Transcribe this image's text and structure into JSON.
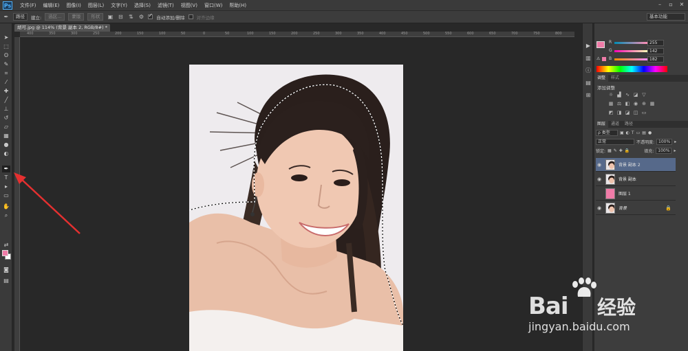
{
  "menubar": {
    "logo": "Ps",
    "items": [
      "文件(F)",
      "编辑(E)",
      "图像(I)",
      "图层(L)",
      "文字(Y)",
      "选择(S)",
      "滤镜(T)",
      "视图(V)",
      "窗口(W)",
      "帮助(H)"
    ]
  },
  "options": {
    "mode": "路径",
    "build_label": "建立:",
    "selection_btn": "选区...",
    "mask_btn": "蒙版",
    "shape_btn": "形状",
    "auto_add_label": "自动添加/删除",
    "align_edges_label": "对齐边缘",
    "auto_add_checked": true,
    "align_edges_checked": false,
    "workspace": "基本功能"
  },
  "document": {
    "tab_title": "胡可.jpg @ 114% (背景 副本 2, RGB/8#) *",
    "ruler_top": [
      "400",
      "350",
      "300",
      "250",
      "200",
      "150",
      "100",
      "50",
      "0",
      "50",
      "100",
      "150",
      "200",
      "250",
      "300",
      "350",
      "400",
      "450",
      "500",
      "550",
      "600",
      "650",
      "700",
      "750",
      "800"
    ]
  },
  "color_panel": {
    "fg_color": "#f07ca8",
    "rows": [
      {
        "label": "R",
        "value": "255"
      },
      {
        "label": "G",
        "value": "142"
      },
      {
        "label": "B",
        "value": "182"
      }
    ]
  },
  "adjustments": {
    "tabs": [
      "调整",
      "样式"
    ],
    "title": "添加调整"
  },
  "layers": {
    "tabs": [
      "图层",
      "通道",
      "路径"
    ],
    "kind_filter": "ρ 类型",
    "blend_mode": "正常",
    "opacity_label": "不透明度:",
    "opacity": "100%",
    "lock_label": "锁定:",
    "fill_label": "填充:",
    "fill": "100%",
    "items": [
      {
        "name": "背景 副本 2",
        "selected": true,
        "visible": true
      },
      {
        "name": "背景 副本",
        "selected": false,
        "visible": true
      },
      {
        "name": "图层 1",
        "selected": false,
        "visible": false
      },
      {
        "name": "背景",
        "selected": false,
        "visible": true
      }
    ]
  },
  "watermark": {
    "brand": "Bai",
    "brand_cn": "经验",
    "url": "jingyan.baidu.com"
  }
}
